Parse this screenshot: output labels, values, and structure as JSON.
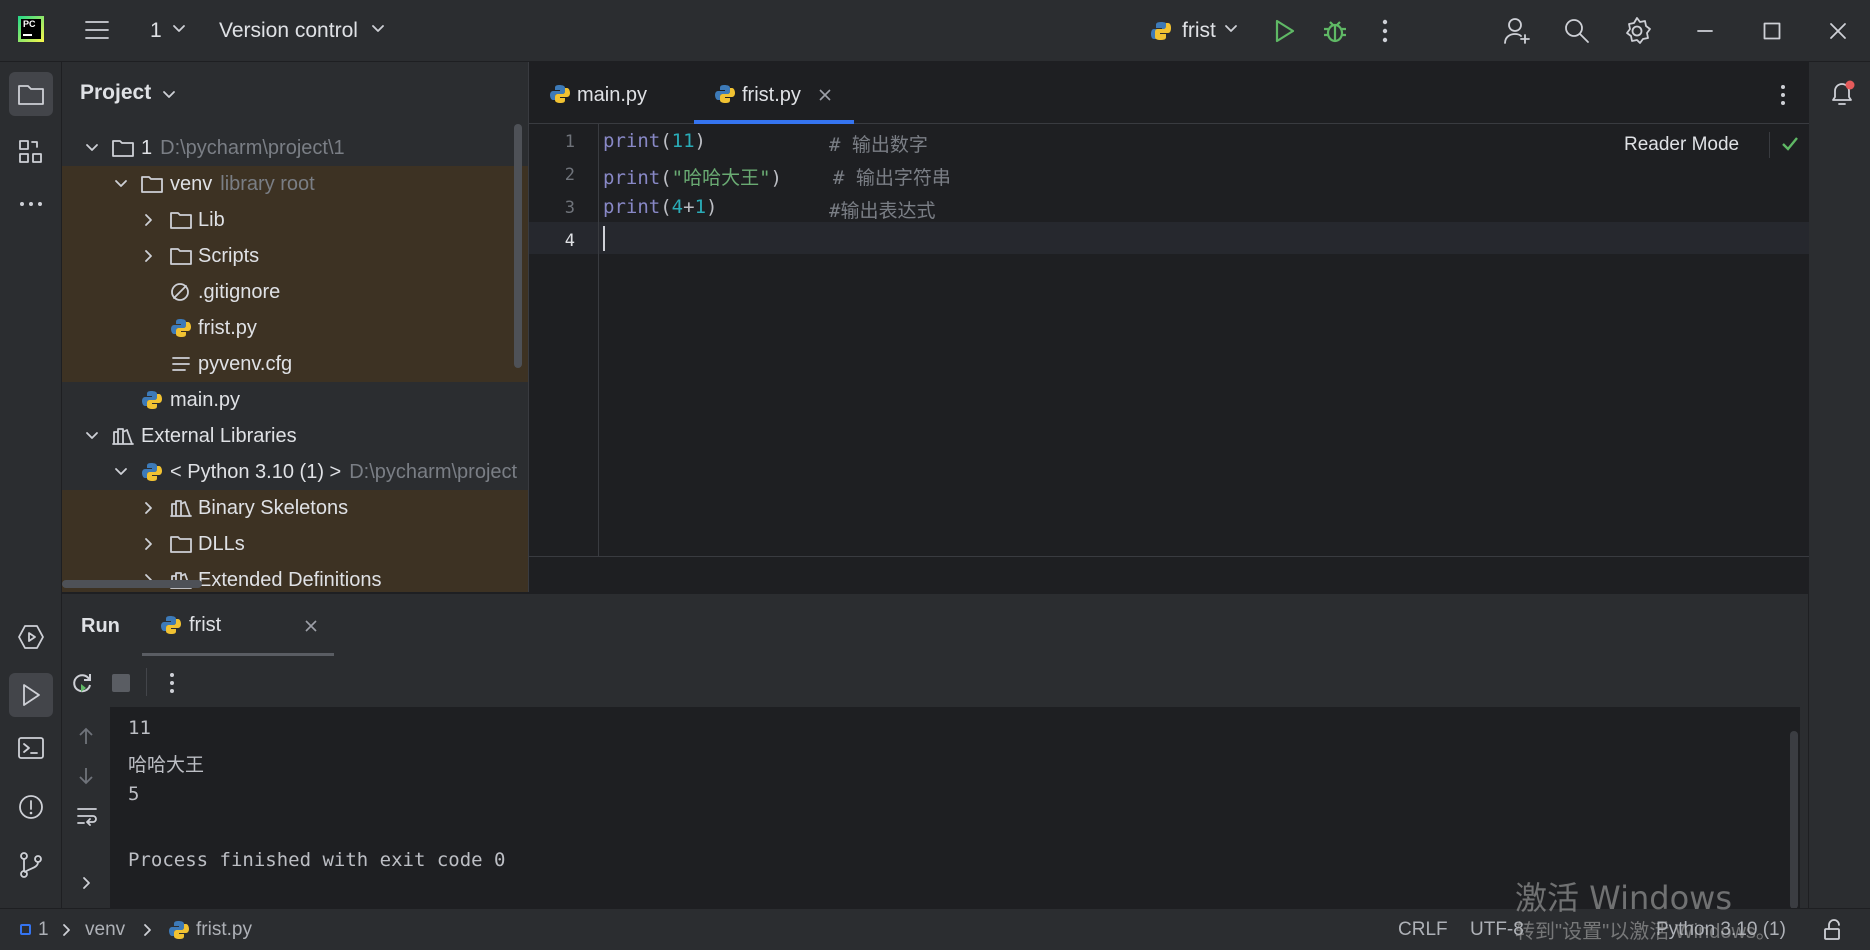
{
  "titlebar": {
    "project_num": "1",
    "vcs": "Version control",
    "run_config": "frist"
  },
  "project_panel": {
    "title": "Project",
    "rows": [
      {
        "label": "1",
        "detail": "D:\\pycharm\\project\\1"
      },
      {
        "label": "venv",
        "detail": "library root"
      },
      {
        "label": "Lib"
      },
      {
        "label": "Scripts"
      },
      {
        "label": ".gitignore"
      },
      {
        "label": "frist.py"
      },
      {
        "label": "pyvenv.cfg"
      },
      {
        "label": "main.py"
      },
      {
        "label": "External Libraries"
      },
      {
        "label": "< Python 3.10 (1) >",
        "detail": "D:\\pycharm\\project"
      },
      {
        "label": "Binary Skeletons"
      },
      {
        "label": "DLLs"
      },
      {
        "label": "Extended Definitions"
      }
    ]
  },
  "editor": {
    "tabs": [
      {
        "label": "main.py"
      },
      {
        "label": "frist.py"
      }
    ],
    "reader_mode": "Reader Mode",
    "line_numbers": [
      "1",
      "2",
      "3",
      "4"
    ],
    "lines": [
      {
        "fn": "print",
        "open": "(",
        "arg": "11",
        "close": ")",
        "comment": "# 输出数字"
      },
      {
        "fn": "print",
        "open": "(",
        "arg": "\"哈哈大王\"",
        "close": ")",
        "comment": "# 输出字符串"
      },
      {
        "fn": "print",
        "open": "(",
        "arg": "4",
        "op": "+",
        "arg2": "1",
        "close": ")",
        "comment": "#输出表达式"
      }
    ]
  },
  "run_panel": {
    "title": "Run",
    "tab": "frist",
    "output": [
      "11",
      "哈哈大王",
      "5",
      "",
      "Process finished with exit code 0"
    ]
  },
  "statusbar": {
    "crumbs": [
      "1",
      "venv",
      "frist.py"
    ],
    "line_sep": "CRLF",
    "encoding": "UTF-8",
    "interpreter": "Python 3.10 (1)"
  },
  "watermark": {
    "title": "激活 Windows",
    "subtitle": "转到\"设置\"以激活 Windows。"
  },
  "colors": {
    "accent": "#3574f0",
    "run_green": "#5fb865",
    "highlight": "#3d3223"
  }
}
